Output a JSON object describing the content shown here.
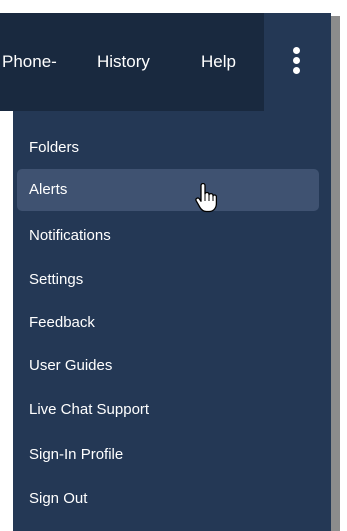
{
  "topnav": {
    "items": [
      {
        "label": "Phone-"
      },
      {
        "label": "History"
      },
      {
        "label": "Help"
      }
    ],
    "more_icon": "kebab-vertical-icon"
  },
  "menu": {
    "items": [
      {
        "label": "Folders"
      },
      {
        "label": "Alerts",
        "state": "hovered"
      },
      {
        "label": "Notifications"
      },
      {
        "label": "Settings"
      },
      {
        "label": "Feedback"
      },
      {
        "label": "User Guides"
      },
      {
        "label": "Live Chat Support"
      },
      {
        "label": "Sign-In Profile"
      },
      {
        "label": "Sign Out"
      }
    ]
  },
  "cursor_icon": "hand-pointer-icon",
  "colors": {
    "nav_background": "#243855",
    "nav_active_background": "#19293f",
    "menu_background": "#243855",
    "menu_hover_background": "#3f5271",
    "text": "#ffffff"
  }
}
